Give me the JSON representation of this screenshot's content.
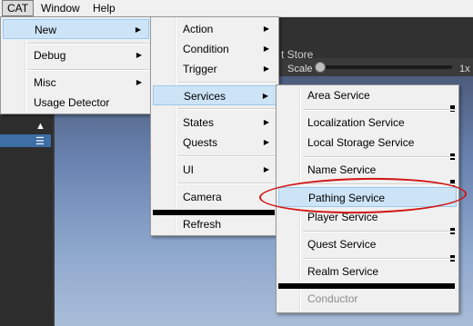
{
  "menubar": {
    "items": [
      "CAT",
      "Window",
      "Help"
    ]
  },
  "scene": {
    "title": "t Store",
    "scale_label": "Scale",
    "zoom_label": "1x"
  },
  "leftpanel": {
    "icons": [
      "thumb-icon",
      "list-icon"
    ]
  },
  "menu_cat": {
    "items": [
      {
        "label": "New",
        "arrow": "▶"
      },
      {
        "label": "Debug",
        "arrow": "▶"
      },
      {
        "label": "Misc",
        "arrow": "▶"
      },
      {
        "label": "Usage Detector",
        "arrow": ""
      }
    ]
  },
  "menu_new": {
    "items": [
      {
        "label": "Action",
        "arrow": "▶"
      },
      {
        "label": "Condition",
        "arrow": "▶"
      },
      {
        "label": "Trigger",
        "arrow": "▶"
      },
      {
        "label": "Services",
        "arrow": "▶"
      },
      {
        "label": "States",
        "arrow": "▶"
      },
      {
        "label": "Quests",
        "arrow": "▶"
      },
      {
        "label": "UI",
        "arrow": "▶"
      },
      {
        "label": "Camera",
        "arrow": ""
      },
      {
        "label": "Refresh",
        "arrow": ""
      }
    ]
  },
  "menu_services": {
    "items": [
      {
        "label": "Area Service"
      },
      {
        "label": "Localization Service"
      },
      {
        "label": "Local Storage Service"
      },
      {
        "label": "Name Service"
      },
      {
        "label": "Pathing Service"
      },
      {
        "label": "Player Service"
      },
      {
        "label": "Quest Service"
      },
      {
        "label": "Realm Service"
      },
      {
        "label": "Conductor"
      }
    ]
  },
  "colors": {
    "highlight": "#cde4f7",
    "annotation": "#d21414"
  }
}
